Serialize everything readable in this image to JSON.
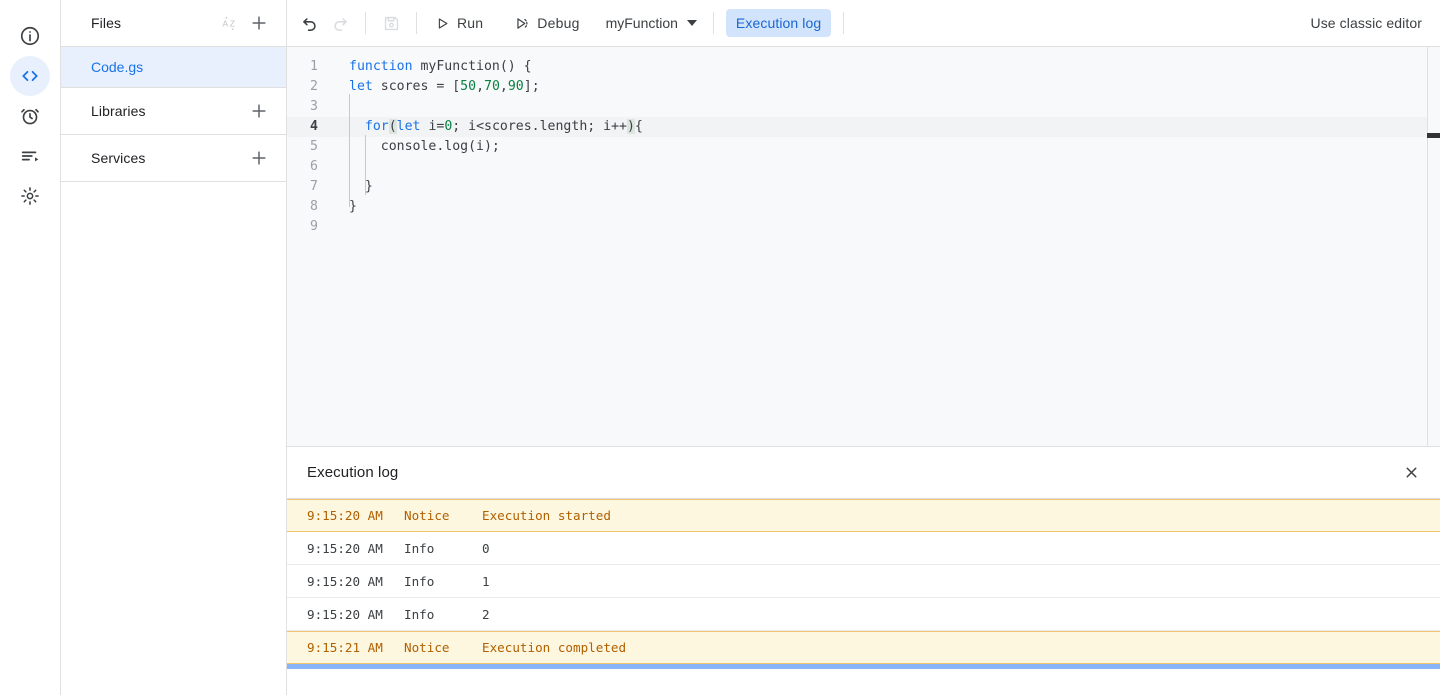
{
  "rail": {
    "items": [
      {
        "name": "overview-icon",
        "label": "Overview",
        "active": false
      },
      {
        "name": "editor-icon",
        "label": "Editor",
        "active": true
      },
      {
        "name": "triggers-icon",
        "label": "Triggers",
        "active": false
      },
      {
        "name": "executions-icon",
        "label": "Executions",
        "active": false
      },
      {
        "name": "settings-icon",
        "label": "Project Settings",
        "active": false
      }
    ]
  },
  "sidebar": {
    "files": {
      "title": "Files",
      "sort_icon": "sort-az-icon",
      "add_icon": "add-icon",
      "items": [
        {
          "label": "Code.gs",
          "selected": true
        }
      ]
    },
    "libraries": {
      "title": "Libraries",
      "add_icon": "add-icon"
    },
    "services": {
      "title": "Services",
      "add_icon": "add-icon"
    }
  },
  "toolbar": {
    "undo_label": "Undo",
    "redo_label": "Redo",
    "save_label": "Save project",
    "run_label": "Run",
    "debug_label": "Debug",
    "function_select": "myFunction",
    "execution_log_chip": "Execution log",
    "classic_editor": "Use classic editor"
  },
  "editor": {
    "language": "javascript",
    "active_line": 4,
    "lines": [
      {
        "n": "1",
        "tokens": [
          {
            "t": "function",
            "c": "kw"
          },
          {
            "t": " myFunction() {",
            "c": "plain"
          }
        ]
      },
      {
        "n": "2",
        "tokens": [
          {
            "t": "let",
            "c": "kw"
          },
          {
            "t": " scores = [",
            "c": "plain"
          },
          {
            "t": "50",
            "c": "num"
          },
          {
            "t": ",",
            "c": "plain"
          },
          {
            "t": "70",
            "c": "num"
          },
          {
            "t": ",",
            "c": "plain"
          },
          {
            "t": "90",
            "c": "num"
          },
          {
            "t": "];",
            "c": "plain"
          }
        ]
      },
      {
        "n": "3",
        "tokens": []
      },
      {
        "n": "4",
        "tokens": [
          {
            "t": "  ",
            "c": "plain"
          },
          {
            "t": "for",
            "c": "kw"
          },
          {
            "t": "(",
            "c": "brk"
          },
          {
            "t": "let",
            "c": "kw"
          },
          {
            "t": " i=",
            "c": "plain"
          },
          {
            "t": "0",
            "c": "num"
          },
          {
            "t": "; i<scores.length; i++",
            "c": "plain"
          },
          {
            "t": ")",
            "c": "brk"
          },
          {
            "t": "{",
            "c": "plain"
          }
        ]
      },
      {
        "n": "5",
        "tokens": [
          {
            "t": "    console.log(i);",
            "c": "plain"
          }
        ]
      },
      {
        "n": "6",
        "tokens": []
      },
      {
        "n": "7",
        "tokens": [
          {
            "t": "  }",
            "c": "plain"
          }
        ]
      },
      {
        "n": "8",
        "tokens": [
          {
            "t": "}",
            "c": "plain"
          }
        ]
      },
      {
        "n": "9",
        "tokens": []
      }
    ]
  },
  "execution_log": {
    "title": "Execution log",
    "close_icon": "close-icon",
    "columns": [
      "time",
      "type",
      "message"
    ],
    "rows": [
      {
        "time": "9:15:20 AM",
        "type": "Notice",
        "message": "Execution started",
        "level": "notice"
      },
      {
        "time": "9:15:20 AM",
        "type": "Info",
        "message": "0",
        "level": "info"
      },
      {
        "time": "9:15:20 AM",
        "type": "Info",
        "message": "1",
        "level": "info"
      },
      {
        "time": "9:15:20 AM",
        "type": "Info",
        "message": "2",
        "level": "info"
      },
      {
        "time": "9:15:21 AM",
        "type": "Notice",
        "message": "Execution completed",
        "level": "notice"
      }
    ]
  },
  "colors": {
    "accent_blue": "#1a73e8",
    "chip_bg": "#d2e3fc",
    "chip_text": "#1967d2",
    "selected_row_bg": "#e8f0fe",
    "notice_bg": "#fef7e0",
    "notice_text": "#b06000",
    "notice_border": "#f0c36d",
    "progress_bar": "#8ab4f8",
    "editor_bg": "#f8f9fa",
    "keyword": "#1a73e8",
    "number": "#0b8043",
    "text": "#3c4043"
  }
}
